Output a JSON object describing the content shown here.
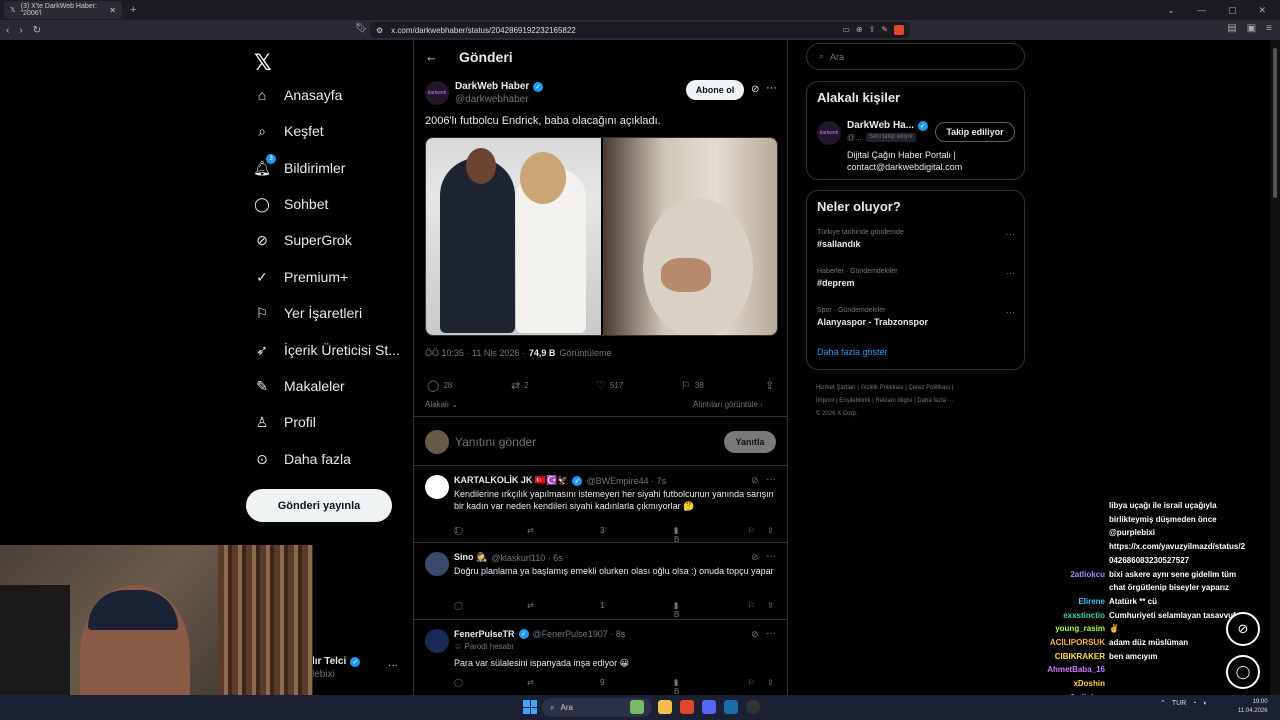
{
  "browser": {
    "tab_title": "(3) X'te DarkWeb Haber: \"2006'l",
    "url": "x.com/darkwebhaber/status/2042869192232165822"
  },
  "sidebar": {
    "items": [
      {
        "label": "Anasayfa",
        "icon": "home-icon"
      },
      {
        "label": "Keşfet",
        "icon": "search-icon"
      },
      {
        "label": "Bildirimler",
        "icon": "bell-icon",
        "badge": "3"
      },
      {
        "label": "Sohbet",
        "icon": "chat-icon"
      },
      {
        "label": "SuperGrok",
        "icon": "grok-icon"
      },
      {
        "label": "Premium+",
        "icon": "premium-icon"
      },
      {
        "label": "Yer İşaretleri",
        "icon": "bookmark-icon"
      },
      {
        "label": "İçerik Üreticisi St...",
        "icon": "rocket-icon"
      },
      {
        "label": "Makaleler",
        "icon": "article-icon"
      },
      {
        "label": "Profil",
        "icon": "person-icon"
      },
      {
        "label": "Daha fazla",
        "icon": "more-circle-icon"
      }
    ],
    "post_button": "Gönderi yayınla",
    "account_name": "lır Telci",
    "account_handle": "lebixi"
  },
  "main": {
    "header_title": "Gönderi",
    "tweet": {
      "author_name": "DarkWeb Haber",
      "author_handle": "@darkwebhaber",
      "avatar_text": "darkweb",
      "subscribe_label": "Abone ol",
      "text": "2006'lı futbolcu Endrick, baba olacağını açıkladı.",
      "time": "ÖÖ 10:35 · 11 Nis 2026 ·",
      "views": "74,9 B",
      "views_label": "Görüntüleme",
      "replies": "28",
      "retweets": "2",
      "likes": "517",
      "bookmarks": "38",
      "sort_label": "Alakalı",
      "quotes_label": "Alıntıları görüntüle"
    },
    "reply_box": {
      "placeholder": "Yanıtını gönder",
      "button": "Yanıtla"
    },
    "replies": [
      {
        "name": "KARTALKOLİK JK 🇹🇷☪️🦅",
        "handle": "@BWEmpire44 · 7s",
        "text": "Kendilerine ırkçılık yapılmasını istemeyen her siyahi futbolcunun yanında sarışın bir kadın var neden kendileri  siyahi kadınlarla çıkmıyorlar 🤔",
        "replies": "1",
        "retweets": "",
        "likes": "3",
        "views": "1 B"
      },
      {
        "name": "Sino 🕵️",
        "handle": "@klaskurl110 · 6s",
        "text": "Doğru planlama ya başlamış emekli olurken olası oğlu olsa :) onuda topçu yapar",
        "replies": "",
        "retweets": "",
        "likes": "1",
        "views": "1 B"
      },
      {
        "name": "FenerPulseTR",
        "handle": "@FenerPulse1907 · 8s",
        "parody": "Parodi hesabı",
        "text": "Para var sülalesini ispanyada inşa ediyor 😀",
        "replies": "",
        "retweets": "",
        "likes": "9",
        "views": "1 B"
      }
    ]
  },
  "right": {
    "search_placeholder": "Ara",
    "related": {
      "title": "Alakalı kişiler",
      "name": "DarkWeb Ha...",
      "handle": "@...",
      "follows_you": "Seni takip ediyor",
      "follow_button": "Takip ediliyor",
      "bio": "Dijital Çağın Haber Portalı | contact@darkwebdigital.com"
    },
    "trends": {
      "title": "Neler oluyor?",
      "items": [
        {
          "context": "Türkiye tarihinde gündemde",
          "name": "#sallandık"
        },
        {
          "context": "Haberler · Gündemdekiler",
          "name": "#deprem"
        },
        {
          "context": "Spor · Gündemdekiler",
          "name": "Alanyaspor - Trabzonspor"
        }
      ],
      "show_more": "Daha fazla göster"
    },
    "footer": {
      "line1": "Hizmet Şartları  |  Gizlilik Politikası  |  Çerez Politikası  |",
      "line2": "İmprint  |  Erişilebilirlik  |  Reklam bilgisi  |  Daha fazla ···",
      "line3": "© 2026 X Corp."
    }
  },
  "chat": {
    "lines": [
      {
        "user": "",
        "msg": "libya uçağı ile israil uçağıyla",
        "color": "#ffffff"
      },
      {
        "user": "",
        "msg": "birlikteymiş düşmeden önce",
        "color": "#ffffff"
      },
      {
        "user": "",
        "msg": "@purplebixi",
        "color": "#ffffff"
      },
      {
        "user": "",
        "msg": "https://x.com/yavuzyilmazd/status/2",
        "color": "#ffffff"
      },
      {
        "user": "",
        "msg": "042686083230527527",
        "color": "#ffffff"
      },
      {
        "user": "2atliokcu",
        "msg": "bixi askere aynı sene gidelim tüm",
        "color": "#9b8cff"
      },
      {
        "user": "",
        "msg": "chat örgütlenip biseyler yaparız",
        "color": "#ffffff"
      },
      {
        "user": "Elirene",
        "msg": "Atatürk ** cü",
        "color": "#3ec1ff"
      },
      {
        "user": "exxstinctio",
        "msg": "Cumhuriyeti selamlayan tasavvufçu",
        "color": "#33d6a6"
      },
      {
        "user": "young_rasim",
        "msg": "✌️",
        "color": "#b6ff3b"
      },
      {
        "user": "ACILIPORSUK",
        "msg": "adam düz müslüman",
        "color": "#ffb33b"
      },
      {
        "user": "CIBIKRAKER",
        "msg": "ben amcıyım",
        "color": "#ffe03b"
      },
      {
        "user": "AhmetBaba_16",
        "msg": "",
        "color": "#c77dff"
      },
      {
        "user": "xDoshin",
        "msg": "",
        "color": "#ffd23b"
      },
      {
        "user": "2atliokcu",
        "msg": "",
        "color": "#9b8cff"
      }
    ]
  },
  "taskbar": {
    "search": "Ara",
    "lang": "TUR",
    "time": "19:00",
    "date": "11.04.2026"
  }
}
